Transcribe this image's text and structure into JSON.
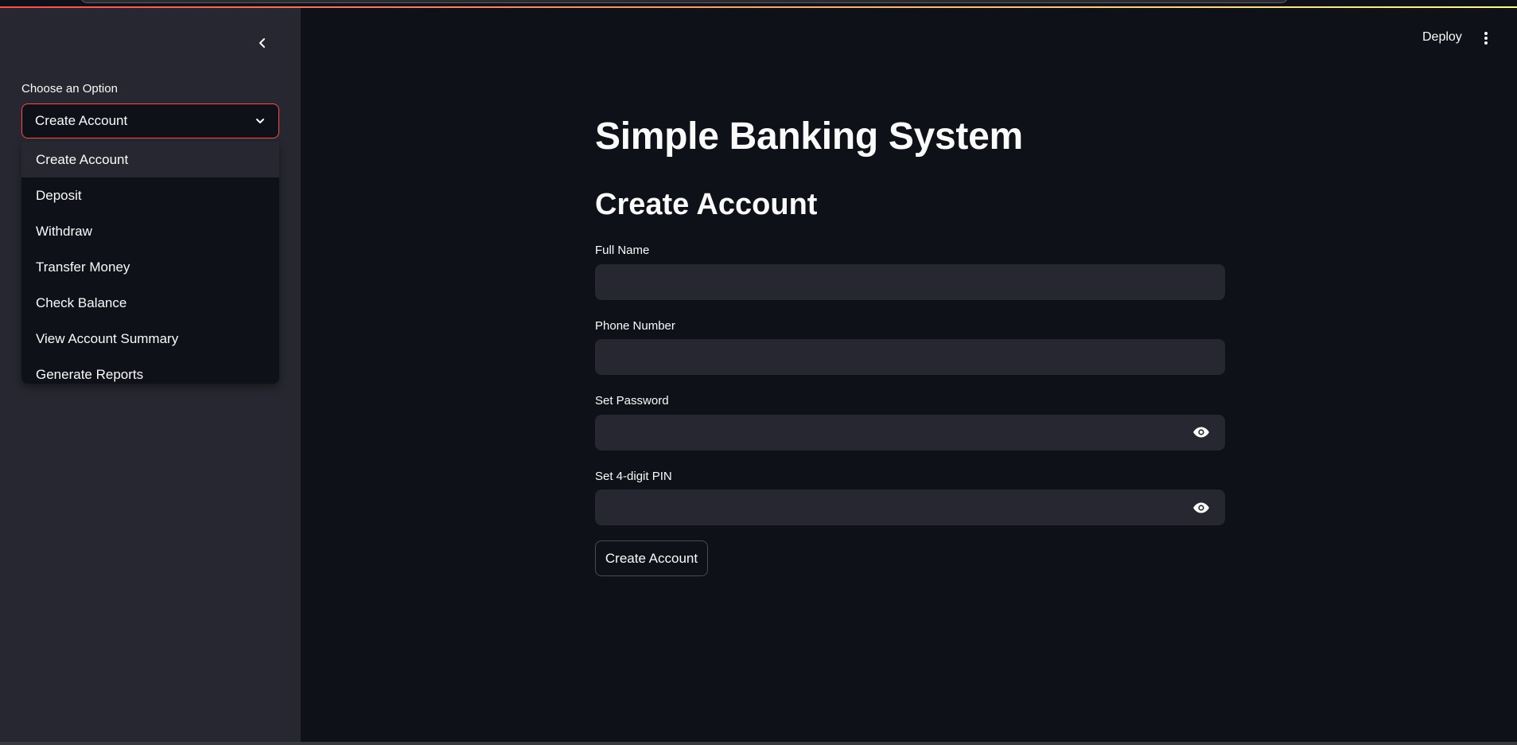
{
  "sidebar": {
    "select_label": "Choose an Option",
    "selected_value": "Create Account",
    "options": [
      "Create Account",
      "Deposit",
      "Withdraw",
      "Transfer Money",
      "Check Balance",
      "View Account Summary",
      "Generate Reports"
    ]
  },
  "header": {
    "deploy_label": "Deploy"
  },
  "main": {
    "title": "Simple Banking System",
    "section_title": "Create Account",
    "fields": {
      "full_name": {
        "label": "Full Name",
        "value": ""
      },
      "phone": {
        "label": "Phone Number",
        "value": ""
      },
      "password": {
        "label": "Set Password",
        "value": ""
      },
      "pin": {
        "label": "Set 4-digit PIN",
        "value": ""
      }
    },
    "submit_label": "Create Account"
  },
  "colors": {
    "background": "#0e1117",
    "sidebar": "#262730",
    "input": "#262730",
    "accent": "#ff4b4b",
    "text": "#fafafa"
  },
  "icons": {
    "collapse": "chevron-left-icon",
    "select": "chevron-down-icon",
    "menu": "more-vertical-icon",
    "password_toggle": "eye-icon"
  }
}
